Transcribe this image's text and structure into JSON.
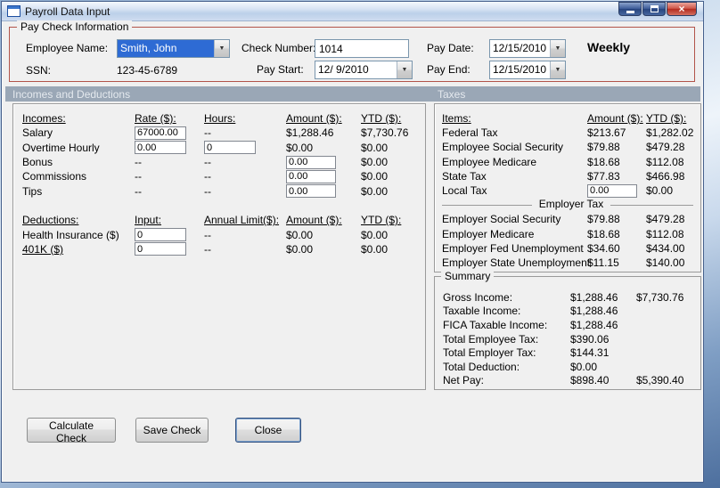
{
  "window": {
    "title": "Payroll Data Input"
  },
  "icons": {
    "dropdown": "▼",
    "close": "×"
  },
  "paycheck": {
    "legend": "Pay Check Information",
    "employee_name_label": "Employee Name:",
    "employee_name_value": "Smith, John",
    "ssn_label": "SSN:",
    "ssn_value": "123-45-6789",
    "check_number_label": "Check Number:",
    "check_number_value": "1014",
    "pay_start_label": "Pay Start:",
    "pay_start_value": "12/ 9/2010",
    "pay_date_label": "Pay Date:",
    "pay_date_value": "12/15/2010",
    "pay_end_label": "Pay End:",
    "pay_end_value": "12/15/2010",
    "frequency": "Weekly"
  },
  "sections": {
    "incomes_deductions": "Incomes and Deductions",
    "taxes": "Taxes"
  },
  "incomes": {
    "headers": {
      "h1": "Incomes:",
      "h2": "Rate ($):",
      "h3": "Hours:",
      "h4": "Amount ($):",
      "h5": "YTD ($):"
    },
    "salary": {
      "label": "Salary",
      "rate": "67000.00",
      "hours": "--",
      "amount": "$1,288.46",
      "ytd": "$7,730.76"
    },
    "overtime": {
      "label": "Overtime Hourly",
      "rate": "0.00",
      "hours": "0",
      "amount": "$0.00",
      "ytd": "$0.00"
    },
    "bonus": {
      "label": "Bonus",
      "rate": "--",
      "hours": "--",
      "amount": "0.00",
      "ytd": "$0.00"
    },
    "commissions": {
      "label": "Commissions",
      "rate": "--",
      "hours": "--",
      "amount": "0.00",
      "ytd": "$0.00"
    },
    "tips": {
      "label": "Tips",
      "rate": "--",
      "hours": "--",
      "amount": "0.00",
      "ytd": "$0.00"
    }
  },
  "deductions": {
    "headers": {
      "h1": "Deductions:",
      "h2": "Input:",
      "h3": "Annual Limit($):",
      "h4": "Amount ($):",
      "h5": "YTD ($):"
    },
    "health": {
      "label": "Health Insurance  ($)",
      "input": "0",
      "limit": "--",
      "amount": "$0.00",
      "ytd": "$0.00"
    },
    "k401": {
      "label": "401K  ($)",
      "input": "0",
      "limit": "--",
      "amount": "$0.00",
      "ytd": "$0.00"
    }
  },
  "taxes": {
    "headers": {
      "h1": "Items:",
      "h2": "Amount ($):",
      "h3": "YTD ($):"
    },
    "rows": [
      {
        "label": "Federal Tax",
        "amount": "$213.67",
        "ytd": "$1,282.02"
      },
      {
        "label": "Employee Social Security",
        "amount": "$79.88",
        "ytd": "$479.28"
      },
      {
        "label": "Employee Medicare",
        "amount": "$18.68",
        "ytd": "$112.08"
      },
      {
        "label": "State Tax",
        "amount": "$77.83",
        "ytd": "$466.98"
      }
    ],
    "local": {
      "label": "Local Tax",
      "amount": "0.00",
      "ytd": "$0.00"
    },
    "employer_header": "Employer Tax",
    "employer_rows": [
      {
        "label": "Employer Social Security",
        "amount": "$79.88",
        "ytd": "$479.28"
      },
      {
        "label": "Employer Medicare",
        "amount": "$18.68",
        "ytd": "$112.08"
      },
      {
        "label": "Employer Fed Unemployment",
        "amount": "$34.60",
        "ytd": "$434.00"
      },
      {
        "label": "Employer State Unemployment",
        "amount": "$11.15",
        "ytd": "$140.00"
      }
    ]
  },
  "summary": {
    "legend": "Summary",
    "rows": [
      {
        "label": "Gross Income:",
        "amount": "$1,288.46",
        "ytd": "$7,730.76"
      },
      {
        "label": "Taxable Income:",
        "amount": "$1,288.46",
        "ytd": ""
      },
      {
        "label": "FICA Taxable Income:",
        "amount": "$1,288.46",
        "ytd": ""
      },
      {
        "label": "Total Employee Tax:",
        "amount": "$390.06",
        "ytd": ""
      },
      {
        "label": "Total Employer Tax:",
        "amount": "$144.31",
        "ytd": ""
      },
      {
        "label": "Total Deduction:",
        "amount": "$0.00",
        "ytd": ""
      },
      {
        "label": "Net Pay:",
        "amount": "$898.40",
        "ytd": "$5,390.40"
      }
    ]
  },
  "buttons": {
    "calculate": "Calculate Check",
    "save": "Save Check",
    "close": "Close"
  },
  "colors": {
    "groupbox_border": "#b2544a",
    "section_band": "#9aa7b6",
    "selection_blue": "#2e6bd4",
    "close_button_red": "#b42c20",
    "window_background": "#f0f0f0"
  }
}
